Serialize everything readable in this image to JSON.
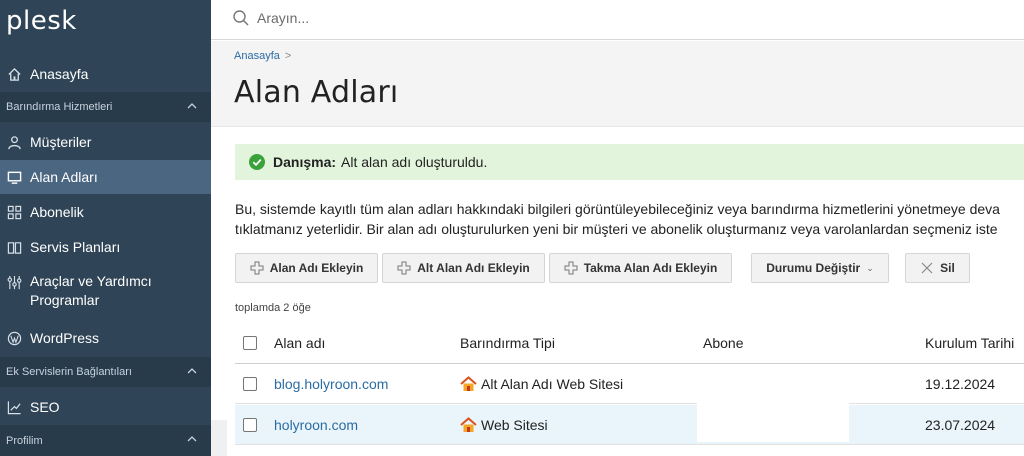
{
  "app": {
    "logo": "plesk"
  },
  "sidebar": {
    "items": [
      {
        "label": "Anasayfa",
        "icon": "home-icon"
      },
      {
        "label": "Müşteriler",
        "icon": "user-icon"
      },
      {
        "label": "Alan Adları",
        "icon": "monitor-icon",
        "active": true
      },
      {
        "label": "Abonelik",
        "icon": "grid-icon"
      },
      {
        "label": "Servis Planları",
        "icon": "book-icon"
      },
      {
        "label": "Araçlar ve Yardımcı Programlar",
        "icon": "tools-icon"
      },
      {
        "label": "WordPress",
        "icon": "wordpress-icon"
      },
      {
        "label": "SEO",
        "icon": "chart-icon"
      }
    ],
    "sections": [
      {
        "label": "Barındırma Hizmetleri"
      },
      {
        "label": "Ek Servislerin Bağlantıları"
      },
      {
        "label": "Profilim"
      }
    ]
  },
  "search": {
    "placeholder": "Arayın..."
  },
  "breadcrumb": {
    "home": "Anasayfa",
    "sep": ">"
  },
  "page": {
    "title": "Alan Adları"
  },
  "message": {
    "strong": "Danışma:",
    "text": "Alt alan adı oluşturuldu."
  },
  "description": {
    "line1": "Bu, sistemde kayıtlı tüm alan adları hakkındaki bilgileri görüntüleyebileceğiniz veya barındırma hizmetlerini yönetmeye deva",
    "line2": "tıklatmanız yeterlidir. Bir alan adı oluşturulurken yeni bir müşteri ve abonelik oluşturmanız veya varolanlardan seçmeniz iste"
  },
  "toolbar": {
    "add_domain": "Alan Adı Ekleyin",
    "add_subdomain": "Alt Alan Adı Ekleyin",
    "add_alias": "Takma Alan Adı Ekleyin",
    "change_status": "Durumu Değiştir",
    "delete": "Sil"
  },
  "list": {
    "count": "toplamda 2 öğe",
    "columns": [
      "Alan adı",
      "Barındırma Tipi",
      "Abone",
      "Kurulum Tarihi"
    ],
    "rows": [
      {
        "domain": "blog.holyroon.com",
        "type": "Alt Alan Adı Web Sitesi",
        "subscriber": "",
        "date": "19.12.2024"
      },
      {
        "domain": "holyroon.com",
        "type": "Web Sitesi",
        "subscriber": "",
        "date": "23.07.2024"
      }
    ]
  },
  "colors": {
    "sidebar": "#2f4456",
    "active": "#4b6680",
    "link": "#2b6ca3",
    "success_bg": "#e3f4dd"
  }
}
